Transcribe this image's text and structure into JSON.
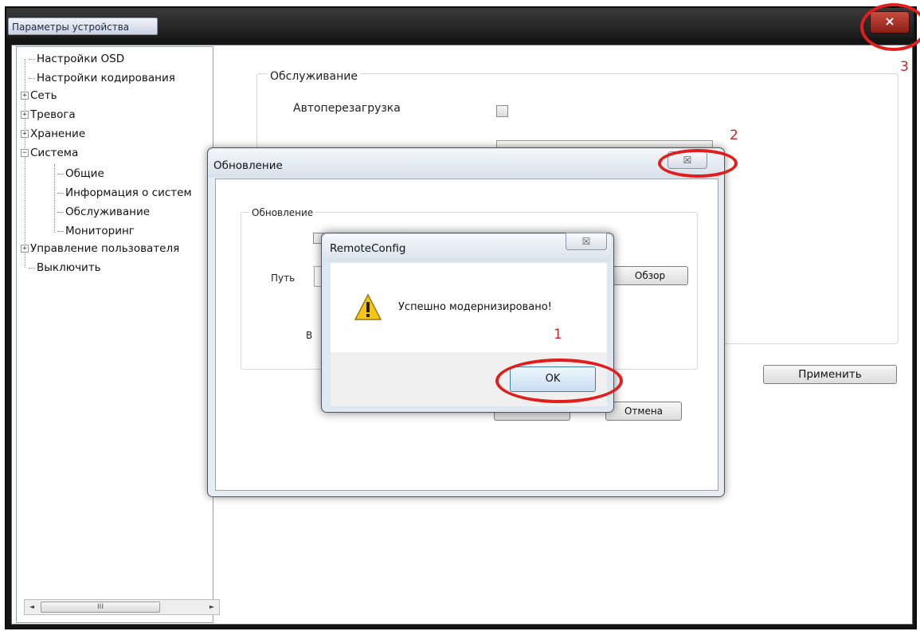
{
  "window": {
    "title": "Параметры устройства",
    "close_label": "×"
  },
  "tree": {
    "items": [
      {
        "label": "Настройки OSD",
        "expander": ""
      },
      {
        "label": "Настройки кодирования",
        "expander": ""
      },
      {
        "label": "Сеть",
        "expander": "+"
      },
      {
        "label": "Тревога",
        "expander": "+"
      },
      {
        "label": "Хранение",
        "expander": "+"
      },
      {
        "label": "Система",
        "expander": "−"
      },
      {
        "label": "Общие",
        "expander": ""
      },
      {
        "label": "Информация о систем",
        "expander": ""
      },
      {
        "label": "Обслуживание",
        "expander": ""
      },
      {
        "label": "Мониторинг",
        "expander": ""
      },
      {
        "label": "Управление пользователя",
        "expander": "+"
      },
      {
        "label": "Выключить",
        "expander": ""
      }
    ],
    "scroll_thumb_label": "III"
  },
  "service": {
    "group_title": "Обслуживание",
    "autoreboot_label": "Автоперезагрузка",
    "apply_label": "Применить"
  },
  "update_dialog": {
    "title": "Обновление",
    "group_title": "Обновление",
    "path_label": "Путь",
    "browse_label": "Обзор",
    "partial_label": "В",
    "cancel_label": "Отмена",
    "close_label": "☒"
  },
  "message_box": {
    "title": "RemoteConfig",
    "message": "Успешно модернизировано!",
    "ok_label": "OK",
    "close_label": "☒"
  },
  "annotations": {
    "one": "1",
    "two": "2",
    "three": "3"
  },
  "colors": {
    "annotation_red": "#e11d1d",
    "ok_border": "#3c7fb1",
    "warning_yellow": "#f5c518"
  }
}
